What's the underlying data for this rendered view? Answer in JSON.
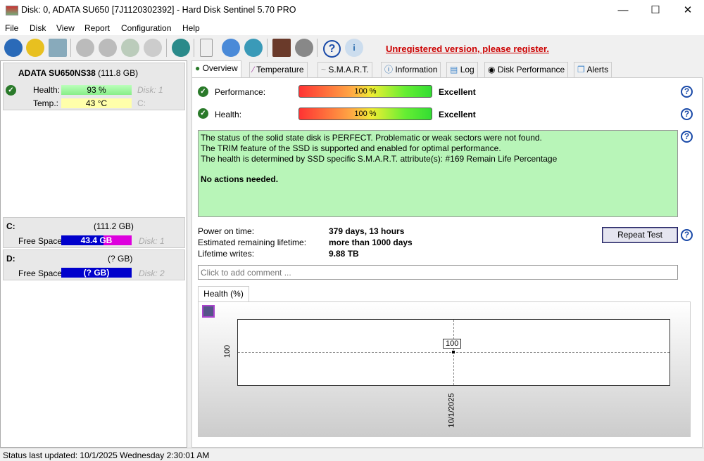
{
  "window": {
    "title": "Disk: 0, ADATA SU650 [7J1120302392]  -  Hard Disk Sentinel 5.70 PRO",
    "minimize": "—",
    "maximize": "☐",
    "close": "✕"
  },
  "menu": [
    "File",
    "Disk",
    "View",
    "Report",
    "Configuration",
    "Help"
  ],
  "toolbar": {
    "register_link": "Unregistered version, please register."
  },
  "disk_card": {
    "name": "ADATA SU650NS38",
    "size": "(111.8 GB)",
    "health_label": "Health:",
    "health_value": "93 %",
    "health_percent": 93,
    "disk_label": "Disk: 1",
    "temp_label": "Temp.:",
    "temp_value": "43 °C",
    "drive_letter": "C:"
  },
  "volumes": [
    {
      "letter": "C:",
      "size": "(111.2 GB)",
      "free_label": "Free Space",
      "free_value": "43.4 GB",
      "disk": "Disk: 1"
    },
    {
      "letter": "D:",
      "size": "(? GB)",
      "free_label": "Free Space",
      "free_value": "(? GB)",
      "disk": "Disk: 2"
    }
  ],
  "tabs": [
    "Overview",
    "Temperature",
    "S.M.A.R.T.",
    "Information",
    "Log",
    "Disk Performance",
    "Alerts"
  ],
  "overview": {
    "performance_label": "Performance:",
    "performance_value": "100 %",
    "performance_rating": "Excellent",
    "health_label": "Health:",
    "health_value": "100 %",
    "health_rating": "Excellent",
    "status_lines": [
      "The status of the solid state disk is PERFECT. Problematic or weak sectors were not found.",
      "The TRIM feature of the SSD is supported and enabled for optimal performance.",
      "The health is determined by SSD specific S.M.A.R.T. attribute(s):  #169 Remain Life Percentage"
    ],
    "actions": "No actions needed.",
    "power_on_label": "Power on time:",
    "power_on_value": "379 days, 13 hours",
    "remaining_label": "Estimated remaining lifetime:",
    "remaining_value": "more than 1000 days",
    "writes_label": "Lifetime writes:",
    "writes_value": "9.88 TB",
    "repeat_test": "Repeat Test",
    "comment_placeholder": "Click to add comment ...",
    "chart_tab": "Health (%)"
  },
  "health_chart": {
    "type": "line",
    "x": [
      "10/1/2025"
    ],
    "values": [
      100
    ],
    "y_tick": "100",
    "point_label": "100",
    "x_tick": "10/1/2025"
  },
  "status_bar": "Status last updated: 10/1/2025 Wednesday 2:30:01 AM"
}
